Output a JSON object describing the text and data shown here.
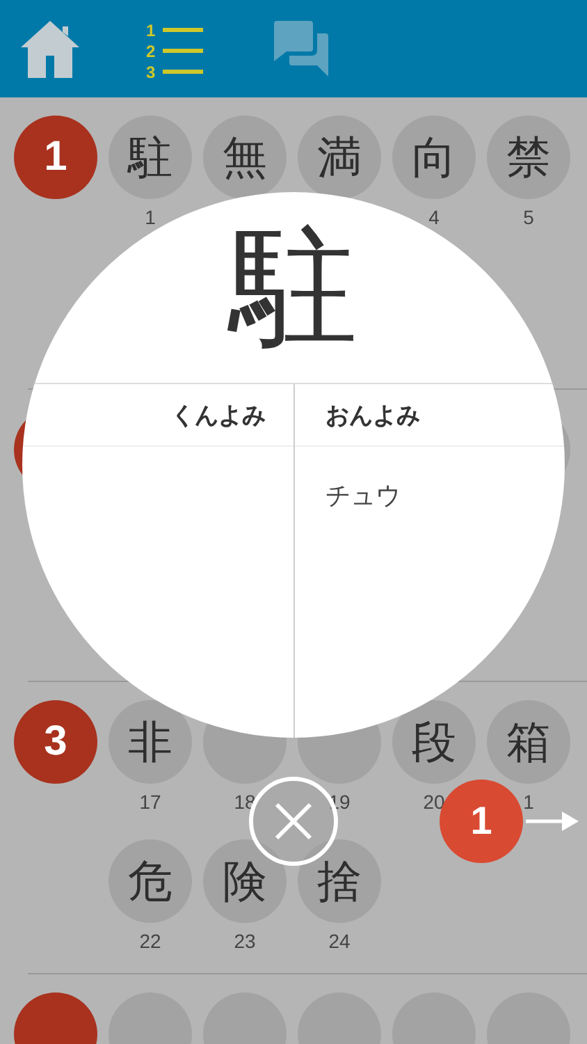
{
  "nav": [
    {
      "kind": "home",
      "selected": false
    },
    {
      "kind": "numbered-list",
      "selected": true,
      "digits": [
        "1",
        "2",
        "3"
      ]
    },
    {
      "kind": "chat",
      "selected": false
    }
  ],
  "lessons": [
    {
      "kind": "visible",
      "number": "1",
      "kanji": [
        {
          "char": "駐",
          "index": "1"
        },
        {
          "char": "無"
        },
        {
          "char": "満"
        },
        {
          "char": "向",
          "index": "4"
        },
        {
          "char": "禁",
          "index": "5"
        }
      ]
    },
    {
      "kind": "covered"
    },
    {
      "kind": "visible",
      "number": "3",
      "kanji": [
        {
          "char": "非",
          "index": "17"
        },
        {
          "index": "18"
        },
        {
          "index": "19"
        },
        {
          "char": "段",
          "index": "20"
        },
        {
          "char": "箱",
          "index": "1"
        },
        {
          "char": "危",
          "index": "22"
        },
        {
          "char": "険",
          "index": "23"
        },
        {
          "char": "捨",
          "index": "24"
        }
      ]
    },
    {
      "kind": "cut"
    }
  ],
  "detail": {
    "kanji": "駐",
    "columns": [
      {
        "heading": "くんよみ"
      },
      {
        "heading": "おんよみ",
        "readings": [
          "チュウ"
        ]
      }
    ]
  },
  "progress_badge": {
    "count": "1"
  }
}
